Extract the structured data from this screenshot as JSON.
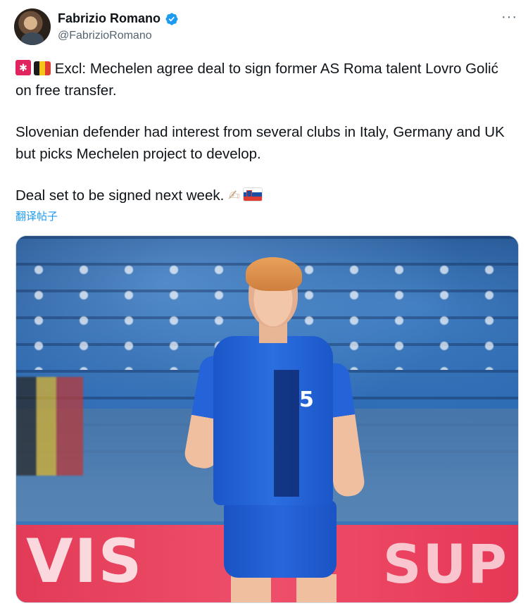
{
  "tweet": {
    "author": {
      "display_name": "Fabrizio Romano",
      "handle": "@FabrizioRomano",
      "verified": true
    },
    "more_menu_label": "···",
    "text": {
      "line1": "Excl: Mechelen agree deal to sign former AS Roma talent Lovro Golić on free transfer.",
      "line2": "Slovenian defender had interest from several clubs in Italy, Germany and UK but picks Mechelen project to develop.",
      "line3": "Deal set to be signed next week."
    },
    "emoji": {
      "line1_prefix": [
        "siren-icon",
        "belgium-flag-icon"
      ],
      "line3_suffix": [
        "writing-hand-icon",
        "slovenia-flag-icon"
      ]
    },
    "translate_label": "翻译帖子",
    "media": {
      "ad_board_left": "VIS",
      "ad_board_right": "SUP",
      "shirt_number": "5"
    }
  },
  "colors": {
    "text_primary": "#0f1419",
    "text_secondary": "#536471",
    "link": "#1d9bf0",
    "verified_badge": "#1d9bf0",
    "jersey": "#2b6ee0",
    "ad_board": "#e23b57"
  }
}
